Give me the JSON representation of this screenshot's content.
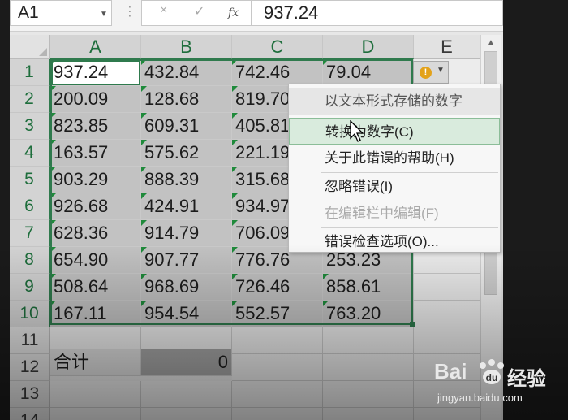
{
  "formula_bar": {
    "name_box": "A1",
    "cancel_icon": "×",
    "enter_icon": "✓",
    "fx_label": "fx",
    "value": "937.24"
  },
  "columns": [
    "A",
    "B",
    "C",
    "D",
    "E"
  ],
  "rows": [
    "1",
    "2",
    "3",
    "4",
    "5",
    "6",
    "7",
    "8",
    "9",
    "10",
    "11",
    "12",
    "13",
    "14"
  ],
  "cells": [
    [
      "937.24",
      "432.84",
      "742.46",
      "79.04"
    ],
    [
      "200.09",
      "128.68",
      "819.70",
      ""
    ],
    [
      "823.85",
      "609.31",
      "405.81",
      ""
    ],
    [
      "163.57",
      "575.62",
      "221.19",
      ""
    ],
    [
      "903.29",
      "888.39",
      "315.68",
      ""
    ],
    [
      "926.68",
      "424.91",
      "934.97",
      ""
    ],
    [
      "628.36",
      "914.79",
      "706.09",
      ""
    ],
    [
      "654.90",
      "907.77",
      "776.76",
      "253.23"
    ],
    [
      "508.64",
      "968.69",
      "726.46",
      "858.61"
    ],
    [
      "167.11",
      "954.54",
      "552.57",
      "763.20"
    ]
  ],
  "total_row": {
    "label": "合计",
    "value": "0"
  },
  "error_menu": {
    "header": "以文本形式存储的数字",
    "items": [
      {
        "label": "转换为数字(C)",
        "state": "hover"
      },
      {
        "label": "关于此错误的帮助(H)",
        "state": "normal"
      },
      {
        "label": "忽略错误(I)",
        "state": "normal"
      },
      {
        "label": "在编辑栏中编辑(F)",
        "state": "disabled"
      },
      {
        "label": "错误检查选项(O)...",
        "state": "normal"
      }
    ]
  },
  "error_button_icon": "!",
  "watermark": {
    "brand": "Bai",
    "brand_cn": "经验",
    "url": "jingyan.baidu.com"
  },
  "colors": {
    "selection_border": "#2f7a4d",
    "error_triangle": "#1f8a3b",
    "warning": "#e3a21a"
  }
}
